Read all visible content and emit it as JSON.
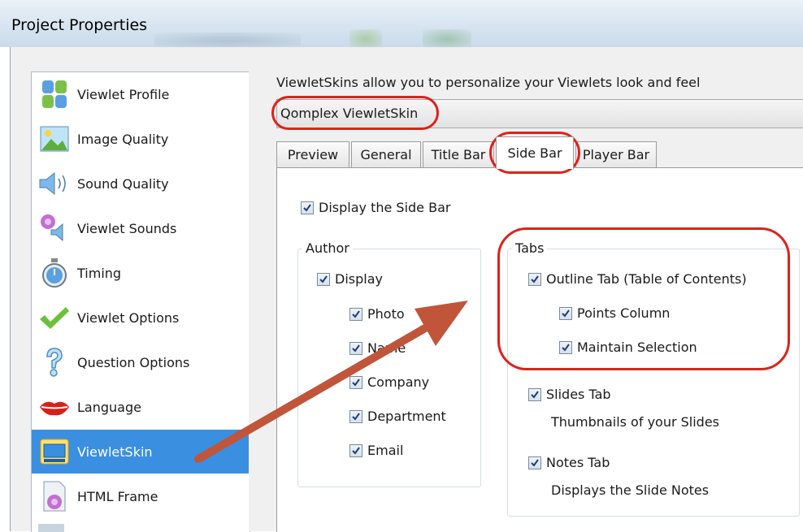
{
  "window": {
    "title": "Project Properties"
  },
  "sidebar": {
    "items": [
      {
        "label": "Viewlet Profile",
        "icon": "viewlet-profile-icon"
      },
      {
        "label": "Image Quality",
        "icon": "image-quality-icon"
      },
      {
        "label": "Sound Quality",
        "icon": "speaker-icon"
      },
      {
        "label": "Viewlet Sounds",
        "icon": "viewlet-sounds-icon"
      },
      {
        "label": "Timing",
        "icon": "stopwatch-icon"
      },
      {
        "label": "Viewlet Options",
        "icon": "checkmark-icon"
      },
      {
        "label": "Question Options",
        "icon": "question-mark-icon"
      },
      {
        "label": "Language",
        "icon": "lips-icon"
      },
      {
        "label": "ViewletSkin",
        "icon": "viewletskin-icon",
        "selected": true
      },
      {
        "label": "HTML Frame",
        "icon": "html-frame-icon"
      }
    ]
  },
  "main": {
    "description": "ViewletSkins allow you to personalize your Viewlets look and feel",
    "skin_selected": "Qomplex ViewletSkin",
    "tabs": [
      "Preview",
      "General",
      "Title Bar",
      "Side Bar",
      "Player Bar"
    ],
    "active_tab": "Side Bar",
    "display_side_bar": "Display the Side Bar",
    "author": {
      "group_label": "Author",
      "display": "Display",
      "items": [
        "Photo",
        "Name",
        "Company",
        "Department",
        "Email"
      ]
    },
    "tabs_group": {
      "group_label": "Tabs",
      "outline_tab": "Outline Tab (Table of Contents)",
      "points_column": "Points Column",
      "maintain_selection": "Maintain Selection",
      "slides_tab": "Slides Tab",
      "slides_desc": "Thumbnails of your Slides",
      "notes_tab": "Notes Tab",
      "notes_desc": "Displays the Slide Notes"
    }
  },
  "colors": {
    "annotation_red": "#e0201a",
    "arrow": "#c0553a",
    "selection_blue": "#3a8fe0"
  }
}
